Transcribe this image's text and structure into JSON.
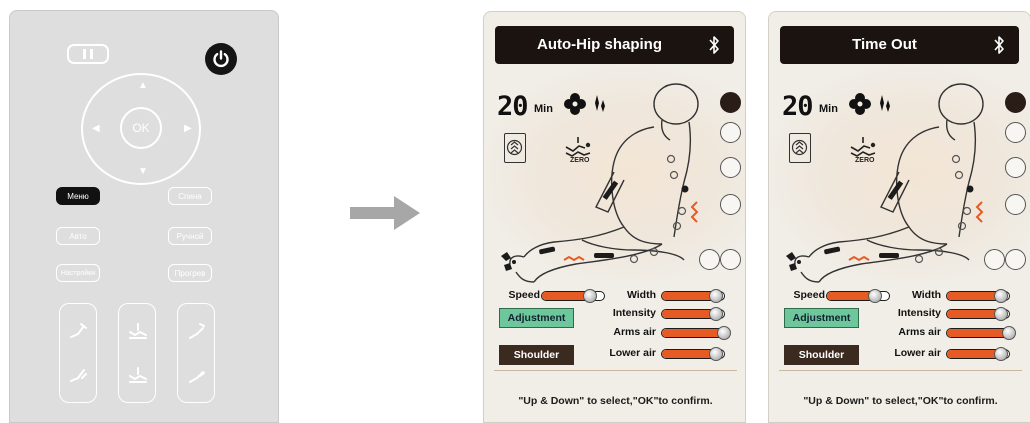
{
  "remote": {
    "ok_label": "OK",
    "buttons": {
      "menu": "Меню",
      "back": "Спина",
      "auto": "Авто",
      "manual": "Ручной",
      "settings": "Настройки",
      "heat": "Прогрев"
    },
    "icons": [
      "pause-icon",
      "power-icon",
      "arrow-up-icon",
      "arrow-down-icon",
      "arrow-left-icon",
      "arrow-right-icon",
      "recline-icon",
      "zero-gravity-icon",
      "leg-icon"
    ]
  },
  "screens": [
    {
      "title": "Auto-Hip shaping",
      "timer": "20",
      "timer_unit": "Min",
      "zero_label": "ZERO",
      "sliders": {
        "speed": {
          "label": "Speed",
          "level": 0.75
        },
        "width": {
          "label": "Width",
          "level": 0.85
        },
        "intensity": {
          "label": "Intensity",
          "level": 0.85
        },
        "arms_air": {
          "label": "Arms air",
          "level": 0.98
        },
        "lower_air": {
          "label": "Lower air",
          "level": 0.85
        }
      },
      "adjustment_label": "Adjustment",
      "shoulder_label": "Shoulder",
      "hint": "\"Up & Down\" to select,\"OK\"to confirm."
    },
    {
      "title": "Time Out",
      "timer": "20",
      "timer_unit": "Min",
      "zero_label": "ZERO",
      "sliders": {
        "speed": {
          "label": "Speed",
          "level": 0.75
        },
        "width": {
          "label": "Width",
          "level": 0.85
        },
        "intensity": {
          "label": "Intensity",
          "level": 0.85
        },
        "arms_air": {
          "label": "Arms air",
          "level": 0.98
        },
        "lower_air": {
          "label": "Lower air",
          "level": 0.85
        }
      },
      "adjustment_label": "Adjustment",
      "shoulder_label": "Shoulder",
      "hint": "\"Up & Down\" to select,\"OK\"to confirm."
    }
  ],
  "colors": {
    "accent_orange": "#e65b24",
    "active_green": "#6dc79a",
    "dark_brown": "#1b130f"
  }
}
